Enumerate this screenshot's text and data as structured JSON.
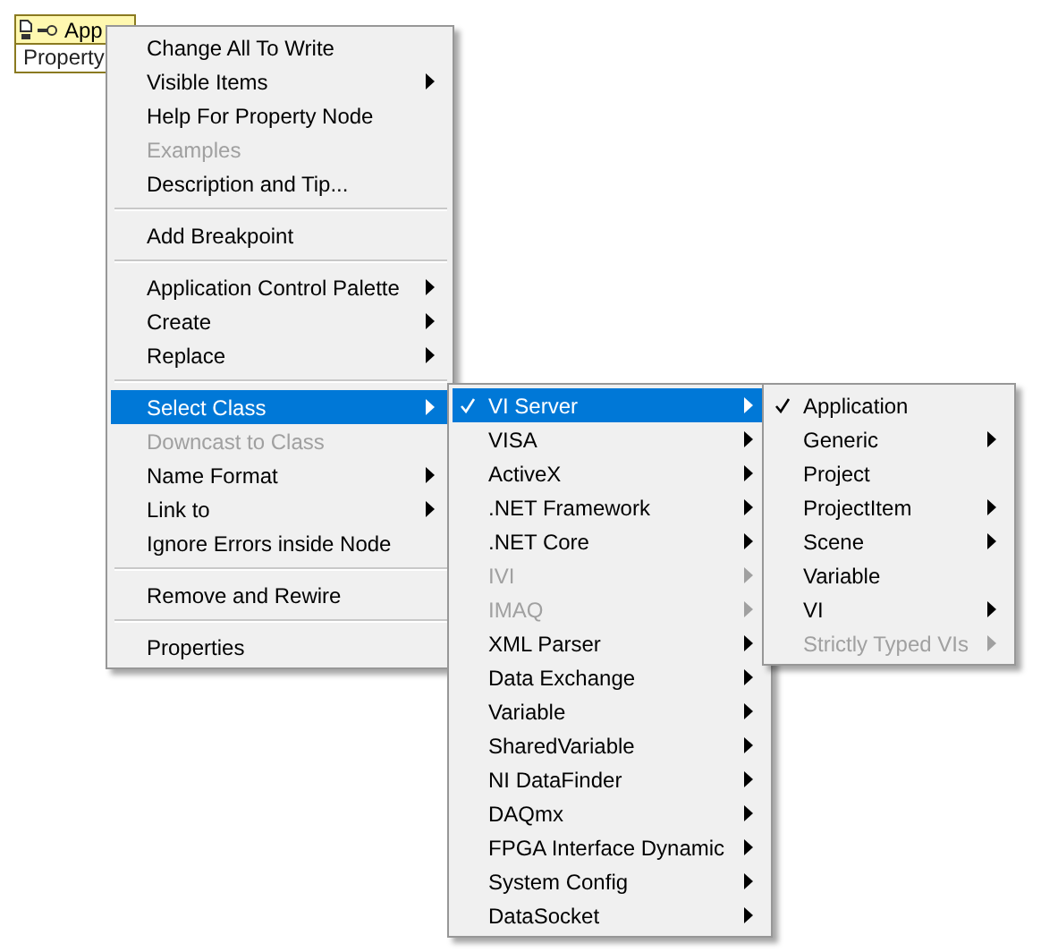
{
  "property_node": {
    "class_label": "App",
    "property_label": "Property"
  },
  "menus": [
    {
      "items": [
        {
          "kind": "item",
          "label": "Change All To Write",
          "disabled": false,
          "submenu": false,
          "checked": false,
          "selected": false
        },
        {
          "kind": "item",
          "label": "Visible Items",
          "disabled": false,
          "submenu": true,
          "checked": false,
          "selected": false
        },
        {
          "kind": "item",
          "label": "Help For Property Node",
          "disabled": false,
          "submenu": false,
          "checked": false,
          "selected": false
        },
        {
          "kind": "item",
          "label": "Examples",
          "disabled": true,
          "submenu": false,
          "checked": false,
          "selected": false
        },
        {
          "kind": "item",
          "label": "Description and Tip...",
          "disabled": false,
          "submenu": false,
          "checked": false,
          "selected": false
        },
        {
          "kind": "separator"
        },
        {
          "kind": "item",
          "label": "Add Breakpoint",
          "disabled": false,
          "submenu": false,
          "checked": false,
          "selected": false
        },
        {
          "kind": "separator"
        },
        {
          "kind": "item",
          "label": "Application Control Palette",
          "disabled": false,
          "submenu": true,
          "checked": false,
          "selected": false
        },
        {
          "kind": "item",
          "label": "Create",
          "disabled": false,
          "submenu": true,
          "checked": false,
          "selected": false
        },
        {
          "kind": "item",
          "label": "Replace",
          "disabled": false,
          "submenu": true,
          "checked": false,
          "selected": false
        },
        {
          "kind": "separator"
        },
        {
          "kind": "item",
          "label": "Select Class",
          "disabled": false,
          "submenu": true,
          "checked": false,
          "selected": true
        },
        {
          "kind": "item",
          "label": "Downcast to Class",
          "disabled": true,
          "submenu": false,
          "checked": false,
          "selected": false
        },
        {
          "kind": "item",
          "label": "Name Format",
          "disabled": false,
          "submenu": true,
          "checked": false,
          "selected": false
        },
        {
          "kind": "item",
          "label": "Link to",
          "disabled": false,
          "submenu": true,
          "checked": false,
          "selected": false
        },
        {
          "kind": "item",
          "label": "Ignore Errors inside Node",
          "disabled": false,
          "submenu": false,
          "checked": false,
          "selected": false
        },
        {
          "kind": "separator"
        },
        {
          "kind": "item",
          "label": "Remove and Rewire",
          "disabled": false,
          "submenu": false,
          "checked": false,
          "selected": false
        },
        {
          "kind": "separator"
        },
        {
          "kind": "item",
          "label": "Properties",
          "disabled": false,
          "submenu": false,
          "checked": false,
          "selected": false
        }
      ]
    },
    {
      "items": [
        {
          "kind": "item",
          "label": "VI Server",
          "disabled": false,
          "submenu": true,
          "checked": true,
          "selected": true
        },
        {
          "kind": "item",
          "label": "VISA",
          "disabled": false,
          "submenu": true,
          "checked": false,
          "selected": false
        },
        {
          "kind": "item",
          "label": "ActiveX",
          "disabled": false,
          "submenu": true,
          "checked": false,
          "selected": false
        },
        {
          "kind": "item",
          "label": ".NET Framework",
          "disabled": false,
          "submenu": true,
          "checked": false,
          "selected": false
        },
        {
          "kind": "item",
          "label": ".NET Core",
          "disabled": false,
          "submenu": true,
          "checked": false,
          "selected": false
        },
        {
          "kind": "item",
          "label": "IVI",
          "disabled": true,
          "submenu": true,
          "checked": false,
          "selected": false
        },
        {
          "kind": "item",
          "label": "IMAQ",
          "disabled": true,
          "submenu": true,
          "checked": false,
          "selected": false
        },
        {
          "kind": "item",
          "label": "XML Parser",
          "disabled": false,
          "submenu": true,
          "checked": false,
          "selected": false
        },
        {
          "kind": "item",
          "label": "Data Exchange",
          "disabled": false,
          "submenu": true,
          "checked": false,
          "selected": false
        },
        {
          "kind": "item",
          "label": "Variable",
          "disabled": false,
          "submenu": true,
          "checked": false,
          "selected": false
        },
        {
          "kind": "item",
          "label": "SharedVariable",
          "disabled": false,
          "submenu": true,
          "checked": false,
          "selected": false
        },
        {
          "kind": "item",
          "label": "NI DataFinder",
          "disabled": false,
          "submenu": true,
          "checked": false,
          "selected": false
        },
        {
          "kind": "item",
          "label": "DAQmx",
          "disabled": false,
          "submenu": true,
          "checked": false,
          "selected": false
        },
        {
          "kind": "item",
          "label": "FPGA Interface Dynamic",
          "disabled": false,
          "submenu": true,
          "checked": false,
          "selected": false
        },
        {
          "kind": "item",
          "label": "System Config",
          "disabled": false,
          "submenu": true,
          "checked": false,
          "selected": false
        },
        {
          "kind": "item",
          "label": "DataSocket",
          "disabled": false,
          "submenu": true,
          "checked": false,
          "selected": false
        }
      ]
    },
    {
      "items": [
        {
          "kind": "item",
          "label": "Application",
          "disabled": false,
          "submenu": false,
          "checked": true,
          "selected": false
        },
        {
          "kind": "item",
          "label": "Generic",
          "disabled": false,
          "submenu": true,
          "checked": false,
          "selected": false
        },
        {
          "kind": "item",
          "label": "Project",
          "disabled": false,
          "submenu": false,
          "checked": false,
          "selected": false
        },
        {
          "kind": "item",
          "label": "ProjectItem",
          "disabled": false,
          "submenu": true,
          "checked": false,
          "selected": false
        },
        {
          "kind": "item",
          "label": "Scene",
          "disabled": false,
          "submenu": true,
          "checked": false,
          "selected": false
        },
        {
          "kind": "item",
          "label": "Variable",
          "disabled": false,
          "submenu": false,
          "checked": false,
          "selected": false
        },
        {
          "kind": "item",
          "label": "VI",
          "disabled": false,
          "submenu": true,
          "checked": false,
          "selected": false
        },
        {
          "kind": "item",
          "label": "Strictly Typed VIs",
          "disabled": true,
          "submenu": true,
          "checked": false,
          "selected": false
        }
      ]
    }
  ]
}
